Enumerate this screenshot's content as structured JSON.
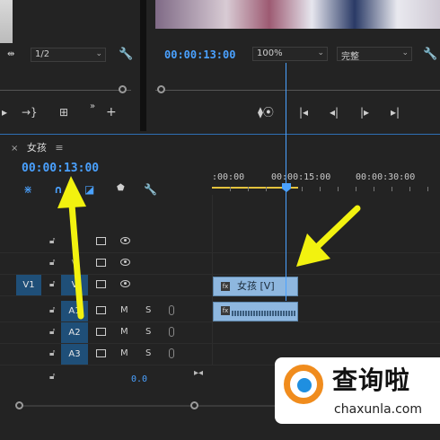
{
  "source_monitor": {
    "resolution": "1/2"
  },
  "program_monitor": {
    "timecode": "00:00:13:00",
    "zoom": "100%",
    "quality": "完整"
  },
  "timeline": {
    "tab_close": "×",
    "tab_title": "女孩",
    "tab_menu": "≡",
    "timecode": "00:00:13:00",
    "ruler_labels": [
      ":00:00",
      "00:00:15:00",
      "00:00:30:00"
    ],
    "tracks": {
      "video": [
        {
          "label": "V"
        },
        {
          "label": "V"
        },
        {
          "label": "V",
          "source": "V1"
        }
      ],
      "audio": [
        {
          "label": "A1",
          "m": "M",
          "s": "S"
        },
        {
          "label": "A2",
          "m": "M",
          "s": "S"
        },
        {
          "label": "A3",
          "m": "M",
          "s": "S"
        }
      ]
    },
    "clip_video_label": "女孩 [V]",
    "clip_fx": "fx",
    "master_value": "0.0"
  },
  "watermark": {
    "title": "查询啦",
    "subtitle": "chaxunla.com"
  },
  "colors": {
    "accent": "#4aa1ff",
    "clip": "#8eb7df",
    "arrow": "#f2f20f",
    "track_patch": "#1f4f78"
  }
}
